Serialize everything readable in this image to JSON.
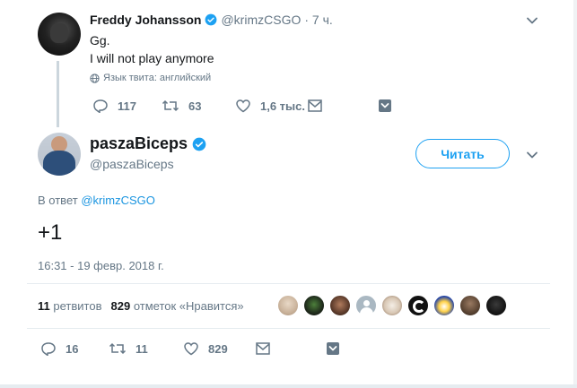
{
  "parent_tweet": {
    "name": "Freddy Johansson",
    "handle": "@krimzCSGO",
    "time": "· 7 ч.",
    "text_line1": "Gg.",
    "text_line2": "I will not play anymore",
    "lang_note": "Язык твита: английский",
    "actions": {
      "replies": "117",
      "retweets": "63",
      "likes": "1,6 тыс."
    }
  },
  "main_tweet": {
    "name": "paszaBiceps",
    "handle": "@paszaBiceps",
    "follow_label": "Читать",
    "reply_prefix": "В ответ",
    "reply_to": "@krimzCSGO",
    "text": "+1",
    "timestamp": "16:31 - 19 февр. 2018 г."
  },
  "stats": {
    "retweets_count": "11",
    "retweets_label": "ретвитов",
    "likes_count": "829",
    "likes_label": "отметок «Нравится»"
  },
  "likers": [
    "liker-1",
    "liker-2",
    "liker-3",
    "liker-4",
    "liker-5",
    "liker-6",
    "liker-7",
    "liker-8",
    "liker-9"
  ],
  "bottom_actions": {
    "replies": "16",
    "retweets": "11",
    "likes": "829"
  },
  "colors": {
    "accent": "#1da1f2",
    "verified": "#1da1f2",
    "muted": "#657786",
    "text": "#14171a",
    "thread_line": "#ccd6dd"
  }
}
